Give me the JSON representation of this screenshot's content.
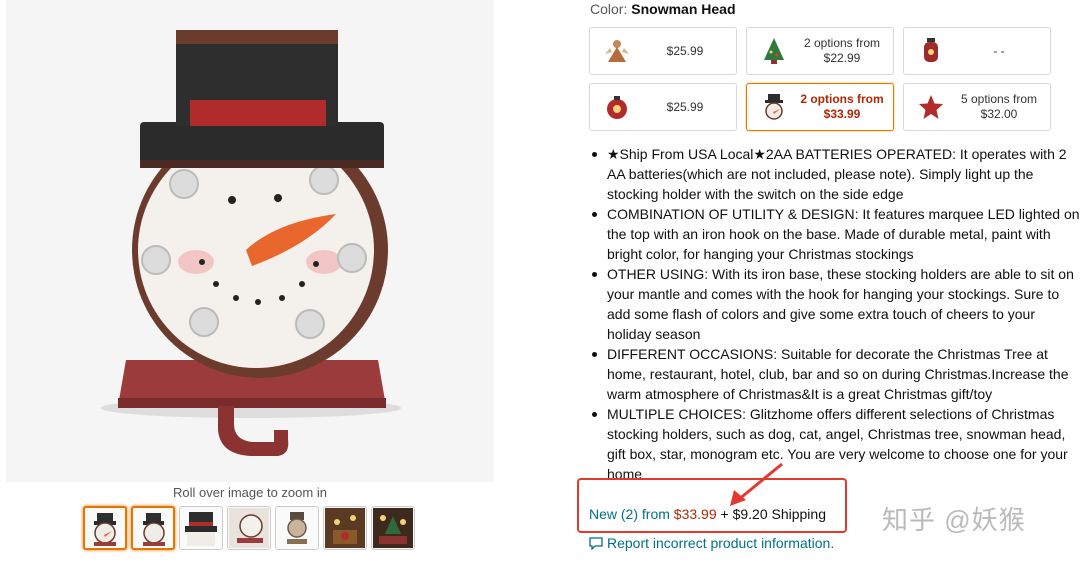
{
  "product_image": {
    "zoom_hint": "Roll over image to zoom in"
  },
  "thumbnails": [
    {
      "name": "snowman-front",
      "selected": true
    },
    {
      "name": "snowman-angle",
      "selected": false
    },
    {
      "name": "snowman-top-hat",
      "selected": false
    },
    {
      "name": "snowman-side",
      "selected": false
    },
    {
      "name": "snowman-back",
      "selected": false
    },
    {
      "name": "holiday-scene-1",
      "selected": false
    },
    {
      "name": "holiday-scene-2",
      "selected": false
    }
  ],
  "color": {
    "label": "Color:",
    "value": "Snowman Head"
  },
  "swatches": [
    {
      "icon": "angel-icon",
      "line1": "$25.99",
      "line2": ""
    },
    {
      "icon": "christmas-tree-icon",
      "line1": "2 options from",
      "line2": "$22.99"
    },
    {
      "icon": "lantern-icon",
      "line1": "- -",
      "line2": ""
    },
    {
      "icon": "ornament-icon",
      "line1": "$25.99",
      "line2": ""
    },
    {
      "icon": "snowman-head-icon",
      "line1": "2 options from",
      "line2": "$33.99",
      "selected": true
    },
    {
      "icon": "star-icon",
      "line1": "5 options from",
      "line2": "$32.00"
    }
  ],
  "bullets": [
    "★Ship From USA Local★2AA BATTERIES OPERATED: It operates with 2 AA batteries(which are not included, please note). Simply light up the stocking holder with the switch on the side edge",
    "COMBINATION OF UTILITY & DESIGN: It features marquee LED lighted on the top with an iron hook on the base. Made of durable metal, paint with bright color, for hanging your Christmas stockings",
    "OTHER USING: With its iron base, these stocking holders are able to sit on your mantle and comes with the hook for hanging your stockings. Sure to add some flash of colors and give some extra touch of cheers to your holiday season",
    "DIFFERENT OCCASIONS: Suitable for decorate the Christmas Tree at home, restaurant, hotel, club, bar and so on during Christmas.Increase the warm atmosphere of Christmas&It is a great Christmas gift/toy",
    "MULTIPLE CHOICES: Glitzhome offers different selections of Christmas stocking holders, such as dog, cat, angel, Christmas tree, snowman head, gift box, star, monogram etc. You are very welcome to choose one for your home"
  ],
  "offer": {
    "link_text": "New (2) from",
    "price": "$33.99",
    "shipping": "+ $9.20 Shipping"
  },
  "report": {
    "label": "Report incorrect product information."
  },
  "watermark": "知乎 @妖猴",
  "colors": {
    "accent": "#e77600",
    "link": "#007185",
    "price": "#b12704",
    "highlight_box": "#e23a2e"
  }
}
